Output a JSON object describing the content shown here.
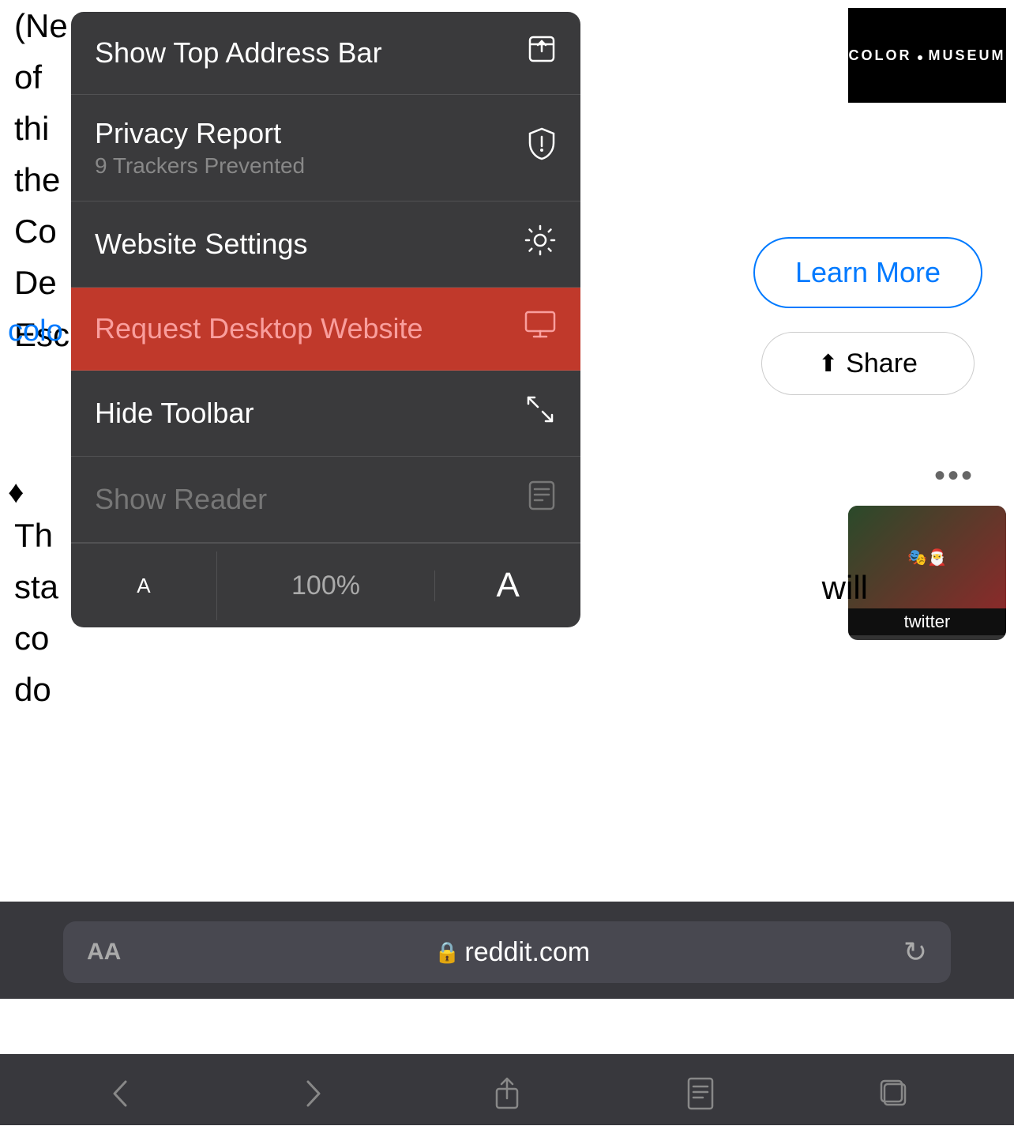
{
  "background": {
    "left_text_lines": [
      "(Ne",
      "of ",
      "thi",
      "the",
      "Co",
      "De",
      "Esc"
    ],
    "blue_link": "colo",
    "ethereum_icon": "♦",
    "bottom_lines": [
      "Th",
      "sta",
      "co",
      "do"
    ],
    "right_will": "will"
  },
  "color_museum": {
    "line1": "COLOR",
    "dot": "•",
    "line2": "MUSEUM"
  },
  "learn_more": {
    "label": "Learn More"
  },
  "share": {
    "label": "Share",
    "icon": "⬆"
  },
  "three_dots": "•••",
  "twitter": {
    "label": "twitter"
  },
  "menu": {
    "items": [
      {
        "title": "Show Top Address Bar",
        "subtitle": null,
        "icon": "⬆",
        "icon_type": "address-bar",
        "active": false,
        "dimmed": false
      },
      {
        "title": "Privacy Report",
        "subtitle": "9 Trackers Prevented",
        "icon": "🛡",
        "icon_type": "shield",
        "active": false,
        "dimmed": false
      },
      {
        "title": "Website Settings",
        "subtitle": null,
        "icon": "⚙",
        "icon_type": "gear",
        "active": false,
        "dimmed": false
      },
      {
        "title": "Request Desktop Website",
        "subtitle": null,
        "icon": "🖥",
        "icon_type": "monitor",
        "active": true,
        "dimmed": false
      },
      {
        "title": "Hide Toolbar",
        "subtitle": null,
        "icon": "↗↙",
        "icon_type": "resize",
        "active": false,
        "dimmed": false
      },
      {
        "title": "Show Reader",
        "subtitle": null,
        "icon": "📄",
        "icon_type": "reader",
        "active": false,
        "dimmed": true
      }
    ],
    "font_size": {
      "small_a": "A",
      "percent": "100%",
      "large_a": "A"
    }
  },
  "browser_bar": {
    "aa_label": "AA",
    "lock_icon": "🔒",
    "url": "reddit.com",
    "reload_icon": "↻"
  },
  "nav_bar": {
    "back_icon": "<",
    "forward_icon": ">",
    "share_icon": "⬆",
    "bookmarks_icon": "📖",
    "tabs_icon": "⧉"
  },
  "home_indicator": true
}
